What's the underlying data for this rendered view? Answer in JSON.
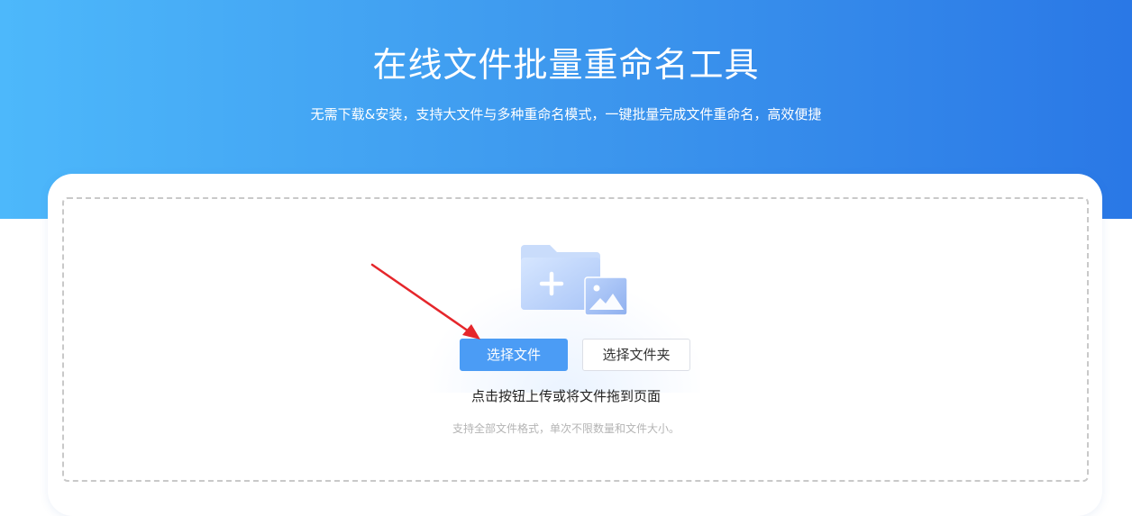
{
  "hero": {
    "title": "在线文件批量重命名工具",
    "subtitle": "无需下载&安装，支持大文件与多种重命名模式，一键批量完成文件重命名，高效便捷"
  },
  "upload": {
    "select_file_label": "选择文件",
    "select_folder_label": "选择文件夹",
    "hint": "点击按钮上传或将文件拖到页面",
    "note": "支持全部文件格式，单次不限数量和文件大小。"
  },
  "icons": {
    "folder": "folder-add-icon",
    "image": "image-icon",
    "annotation": "red-arrow-annotation"
  },
  "colors": {
    "hero_start": "#4db8fb",
    "hero_end": "#2a78e6",
    "primary_button": "#4b9cf5",
    "annotation_arrow": "#e5262b"
  }
}
